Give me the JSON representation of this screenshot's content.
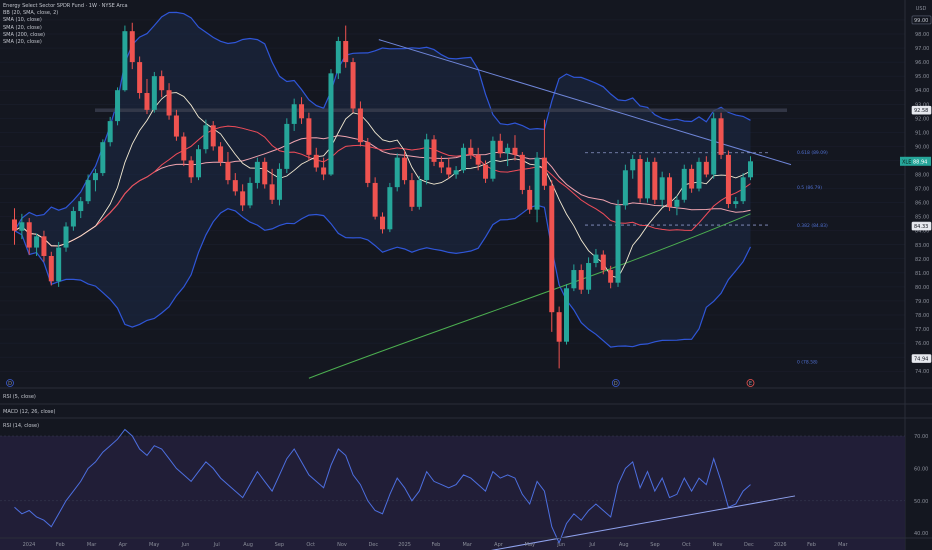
{
  "legend": {
    "title": "Energy Select Sector SPDR Fund · 1W · NYSE Arca",
    "indicators": [
      "BB (20, SMA, close, 2)",
      "SMA (10, close)",
      "SMA (20, close)",
      "SMA (200, close)",
      "SMA (20, close)"
    ]
  },
  "panes": {
    "rsi5_label": "RSI (5, close)",
    "macd_label": "MACD (12, 26, close)",
    "rsi14_label": "RSI (14, close)"
  },
  "currency": "USD",
  "colors": {
    "background": "#141720",
    "up": "#26a69a",
    "down": "#ef5350",
    "bollinger": "#2f56d8",
    "bollinger_fill": "#1b2947",
    "sma10": "#f3ead2",
    "sma20": "#ec4a57",
    "sma50": "#f0a4b0",
    "sma200": "#4caf50",
    "rsi": "#4d6fe0",
    "trendline": "#6f86d9"
  },
  "price_axis": {
    "ticks": [
      "99.00",
      "98.00",
      "97.00",
      "96.00",
      "95.00",
      "94.00",
      "93.00",
      "92.00",
      "91.00",
      "90.00",
      "89.00",
      "88.00",
      "87.00",
      "86.00",
      "85.00",
      "84.00",
      "83.00",
      "82.00",
      "81.00",
      "80.00",
      "79.00",
      "78.00",
      "77.00",
      "76.00",
      "75.00",
      "74.00"
    ]
  },
  "price_tags": {
    "top": "99.00",
    "resistance": "92.58",
    "last_prefix": "XLE",
    "last": "88.94",
    "support": "84.33",
    "bottom": "74.94"
  },
  "fib_labels": {
    "f0618": "0.618 (89.09)",
    "f05": "0.5 (86.79)",
    "f0382": "0.382 (84.83)",
    "f0": "0 (78.58)"
  },
  "rsi_axis": {
    "ticks": [
      "70.00",
      "60.00",
      "50.00",
      "40.00",
      "30.00"
    ]
  },
  "time_axis": {
    "labels": [
      "2024",
      "Feb",
      "Mar",
      "Apr",
      "May",
      "Jun",
      "Jul",
      "Aug",
      "Sep",
      "Oct",
      "Nov",
      "Dec",
      "2025",
      "Feb",
      "Mar",
      "Apr",
      "May",
      "Jun",
      "Jul",
      "Aug",
      "Sep",
      "Oct",
      "Nov",
      "Dec",
      "2026",
      "Feb",
      "Mar"
    ]
  },
  "events": {
    "marker": "D",
    "alert_marker": "E",
    "weeks": [
      -3,
      19,
      32,
      45,
      58,
      71,
      84
    ]
  },
  "chart_data": {
    "type": "candlestick",
    "title": "Energy Select Sector SPDR Fund · 1W · NYSE Arca",
    "xlabel": "",
    "ylabel": "USD",
    "ylim": [
      74.0,
      99.5
    ],
    "x_start_week_label": "2024",
    "candles_ohlc": [
      [
        84.8,
        85.6,
        83.0,
        84.0
      ],
      [
        84.0,
        85.2,
        83.4,
        84.6
      ],
      [
        84.6,
        84.9,
        82.3,
        82.8
      ],
      [
        82.8,
        83.8,
        82.2,
        83.6
      ],
      [
        83.6,
        84.0,
        81.8,
        82.2
      ],
      [
        82.2,
        82.5,
        80.1,
        80.4
      ],
      [
        80.4,
        83.2,
        80.0,
        82.8
      ],
      [
        82.8,
        84.6,
        82.5,
        84.3
      ],
      [
        84.3,
        85.7,
        84.0,
        85.4
      ],
      [
        85.4,
        86.4,
        84.9,
        86.1
      ],
      [
        86.1,
        88.0,
        85.9,
        87.6
      ],
      [
        87.6,
        88.4,
        86.8,
        88.1
      ],
      [
        88.1,
        90.5,
        87.9,
        90.3
      ],
      [
        90.3,
        92.1,
        90.0,
        91.8
      ],
      [
        91.8,
        94.2,
        91.5,
        94.0
      ],
      [
        94.0,
        98.6,
        93.9,
        98.2
      ],
      [
        98.2,
        98.8,
        95.5,
        96.0
      ],
      [
        96.0,
        96.4,
        93.4,
        93.8
      ],
      [
        93.8,
        94.8,
        92.3,
        92.6
      ],
      [
        92.6,
        95.3,
        92.4,
        95.0
      ],
      [
        95.0,
        95.4,
        93.5,
        94.0
      ],
      [
        94.0,
        94.5,
        91.9,
        92.2
      ],
      [
        92.2,
        92.6,
        90.4,
        90.7
      ],
      [
        90.7,
        91.0,
        88.6,
        89.0
      ],
      [
        89.0,
        89.3,
        87.4,
        87.8
      ],
      [
        87.8,
        90.1,
        87.6,
        89.8
      ],
      [
        89.8,
        91.9,
        89.5,
        91.5
      ],
      [
        91.5,
        91.8,
        89.7,
        90.0
      ],
      [
        90.0,
        90.3,
        88.6,
        88.9
      ],
      [
        88.9,
        89.6,
        87.3,
        87.6
      ],
      [
        87.6,
        88.1,
        86.5,
        86.8
      ],
      [
        86.8,
        87.3,
        85.4,
        85.8
      ],
      [
        85.8,
        87.8,
        85.6,
        87.4
      ],
      [
        87.4,
        89.2,
        87.0,
        88.9
      ],
      [
        88.9,
        89.2,
        87.0,
        87.3
      ],
      [
        87.3,
        88.4,
        85.9,
        86.2
      ],
      [
        86.2,
        88.8,
        85.8,
        88.4
      ],
      [
        88.4,
        92.0,
        88.1,
        91.6
      ],
      [
        91.6,
        93.4,
        91.1,
        93.0
      ],
      [
        93.0,
        93.5,
        91.6,
        92.0
      ],
      [
        92.0,
        92.4,
        89.0,
        89.4
      ],
      [
        89.4,
        89.9,
        88.2,
        88.5
      ],
      [
        88.5,
        89.2,
        87.6,
        88.0
      ],
      [
        88.0,
        95.5,
        87.9,
        95.2
      ],
      [
        95.2,
        97.8,
        94.8,
        97.5
      ],
      [
        97.5,
        98.6,
        95.6,
        96.0
      ],
      [
        96.0,
        96.3,
        92.4,
        92.7
      ],
      [
        92.7,
        93.2,
        90.0,
        90.3
      ],
      [
        90.3,
        90.6,
        87.1,
        87.4
      ],
      [
        87.4,
        87.8,
        84.8,
        85.0
      ],
      [
        85.0,
        85.3,
        83.8,
        84.1
      ],
      [
        84.1,
        87.4,
        83.9,
        87.1
      ],
      [
        87.1,
        89.5,
        86.8,
        89.2
      ],
      [
        89.2,
        89.7,
        87.3,
        87.6
      ],
      [
        87.6,
        88.1,
        85.4,
        85.7
      ],
      [
        85.7,
        87.9,
        85.5,
        87.6
      ],
      [
        87.6,
        90.9,
        87.3,
        90.5
      ],
      [
        90.5,
        90.8,
        88.6,
        88.9
      ],
      [
        88.9,
        89.3,
        88.1,
        88.5
      ],
      [
        88.5,
        89.2,
        87.7,
        88.0
      ],
      [
        88.0,
        88.6,
        87.7,
        88.3
      ],
      [
        88.3,
        90.2,
        88.1,
        89.9
      ],
      [
        89.9,
        90.5,
        89.1,
        89.4
      ],
      [
        89.4,
        89.9,
        88.3,
        88.7
      ],
      [
        88.7,
        89.0,
        87.4,
        87.7
      ],
      [
        87.7,
        90.7,
        87.5,
        90.4
      ],
      [
        90.4,
        90.9,
        89.2,
        89.5
      ],
      [
        89.5,
        90.2,
        88.6,
        89.9
      ],
      [
        89.9,
        90.8,
        89.0,
        89.4
      ],
      [
        89.4,
        89.6,
        86.6,
        86.9
      ],
      [
        86.9,
        87.2,
        85.2,
        85.5
      ],
      [
        85.5,
        89.6,
        84.6,
        89.2
      ],
      [
        89.2,
        91.9,
        86.9,
        87.2
      ],
      [
        87.2,
        87.6,
        76.8,
        78.2
      ],
      [
        78.2,
        78.6,
        74.2,
        76.1
      ],
      [
        76.1,
        80.2,
        75.9,
        79.9
      ],
      [
        79.9,
        81.6,
        79.7,
        81.2
      ],
      [
        81.2,
        81.6,
        79.5,
        79.8
      ],
      [
        79.8,
        82.1,
        79.5,
        81.7
      ],
      [
        81.7,
        82.7,
        81.4,
        82.3
      ],
      [
        82.3,
        82.6,
        80.9,
        81.2
      ],
      [
        81.2,
        81.5,
        79.9,
        80.3
      ],
      [
        80.3,
        86.2,
        80.0,
        85.8
      ],
      [
        85.8,
        88.7,
        85.5,
        88.3
      ],
      [
        88.3,
        89.4,
        87.7,
        89.1
      ],
      [
        89.1,
        89.4,
        86.0,
        86.3
      ],
      [
        86.3,
        89.2,
        86.0,
        88.9
      ],
      [
        88.9,
        89.2,
        85.9,
        86.2
      ],
      [
        86.2,
        88.2,
        85.7,
        87.8
      ],
      [
        87.8,
        88.1,
        85.4,
        85.7
      ],
      [
        85.7,
        86.5,
        85.1,
        86.2
      ],
      [
        86.2,
        88.7,
        86.0,
        88.4
      ],
      [
        88.4,
        88.7,
        86.7,
        87.0
      ],
      [
        87.0,
        89.2,
        86.8,
        88.9
      ],
      [
        88.9,
        89.3,
        87.8,
        88.0
      ],
      [
        88.0,
        92.4,
        87.7,
        92.0
      ],
      [
        92.0,
        92.4,
        89.1,
        89.4
      ],
      [
        89.4,
        89.7,
        85.6,
        85.9
      ],
      [
        85.9,
        86.4,
        85.6,
        86.1
      ],
      [
        86.1,
        88.1,
        85.9,
        87.8
      ],
      [
        87.8,
        89.3,
        87.6,
        88.94
      ]
    ],
    "rsi14": [
      48,
      46,
      47,
      45,
      44,
      42,
      46,
      50,
      53,
      56,
      60,
      62,
      65,
      67,
      69,
      72,
      70,
      66,
      64,
      67,
      66,
      63,
      60,
      58,
      56,
      59,
      62,
      60,
      57,
      55,
      53,
      51,
      55,
      59,
      56,
      53,
      58,
      63,
      66,
      62,
      58,
      56,
      54,
      61,
      66,
      64,
      58,
      55,
      50,
      47,
      46,
      52,
      57,
      54,
      50,
      53,
      59,
      56,
      55,
      54,
      55,
      58,
      57,
      55,
      53,
      59,
      57,
      58,
      57,
      52,
      49,
      56,
      53,
      42,
      37,
      43,
      46,
      44,
      47,
      49,
      47,
      45,
      55,
      60,
      62,
      54,
      59,
      53,
      57,
      51,
      52,
      57,
      53,
      57,
      55,
      63,
      56,
      48,
      49,
      53,
      55
    ],
    "series_notes": [
      "BB (20, SMA, close, 2)",
      "SMA (10, close)",
      "SMA (20, close)",
      "SMA (200, close)",
      "SMA (20, close)"
    ]
  }
}
